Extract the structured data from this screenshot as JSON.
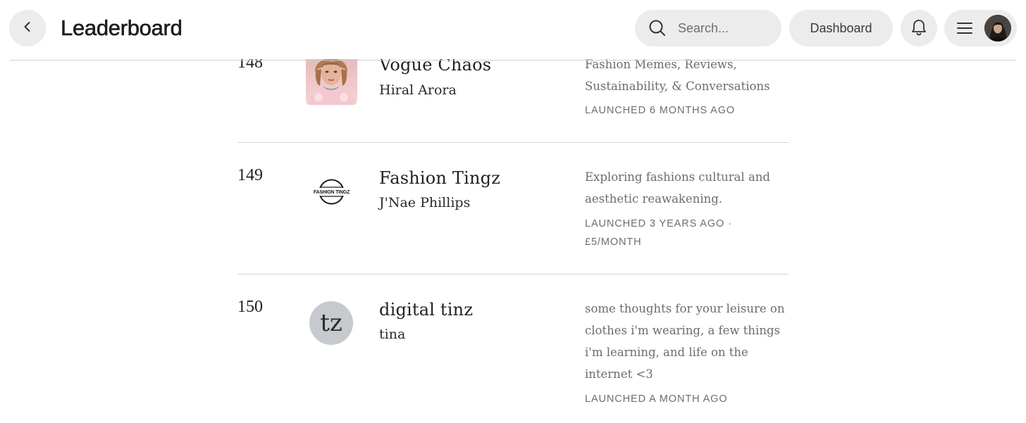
{
  "header": {
    "title": "Leaderboard",
    "search_placeholder": "Search...",
    "dashboard_label": "Dashboard"
  },
  "entries": [
    {
      "rank": "148",
      "name": "Vogue Chaos",
      "author": "Hiral Arora",
      "description": "Fashion Memes, Reviews, Sustainability, & Conversations",
      "meta": "LAUNCHED 6 MONTHS AGO"
    },
    {
      "rank": "149",
      "name": "Fashion Tingz",
      "author": "J'Nae Phillips",
      "description": "Exploring fashions cultural and aesthetic reawakening.",
      "meta": "LAUNCHED 3 YEARS AGO · £5/MONTH",
      "logo_text": "FASHION TINGZ"
    },
    {
      "rank": "150",
      "name": "digital tinz",
      "author": "tina",
      "description": "some thoughts for your leisure on clothes i'm wearing, a few things i'm learning, and life on the internet <3",
      "meta": "LAUNCHED A MONTH AGO",
      "initials": "tz"
    }
  ],
  "colors": {
    "pill_background": "#ececec",
    "divider": "#d6d6d6",
    "initials_circle": "#c6c9cd"
  }
}
